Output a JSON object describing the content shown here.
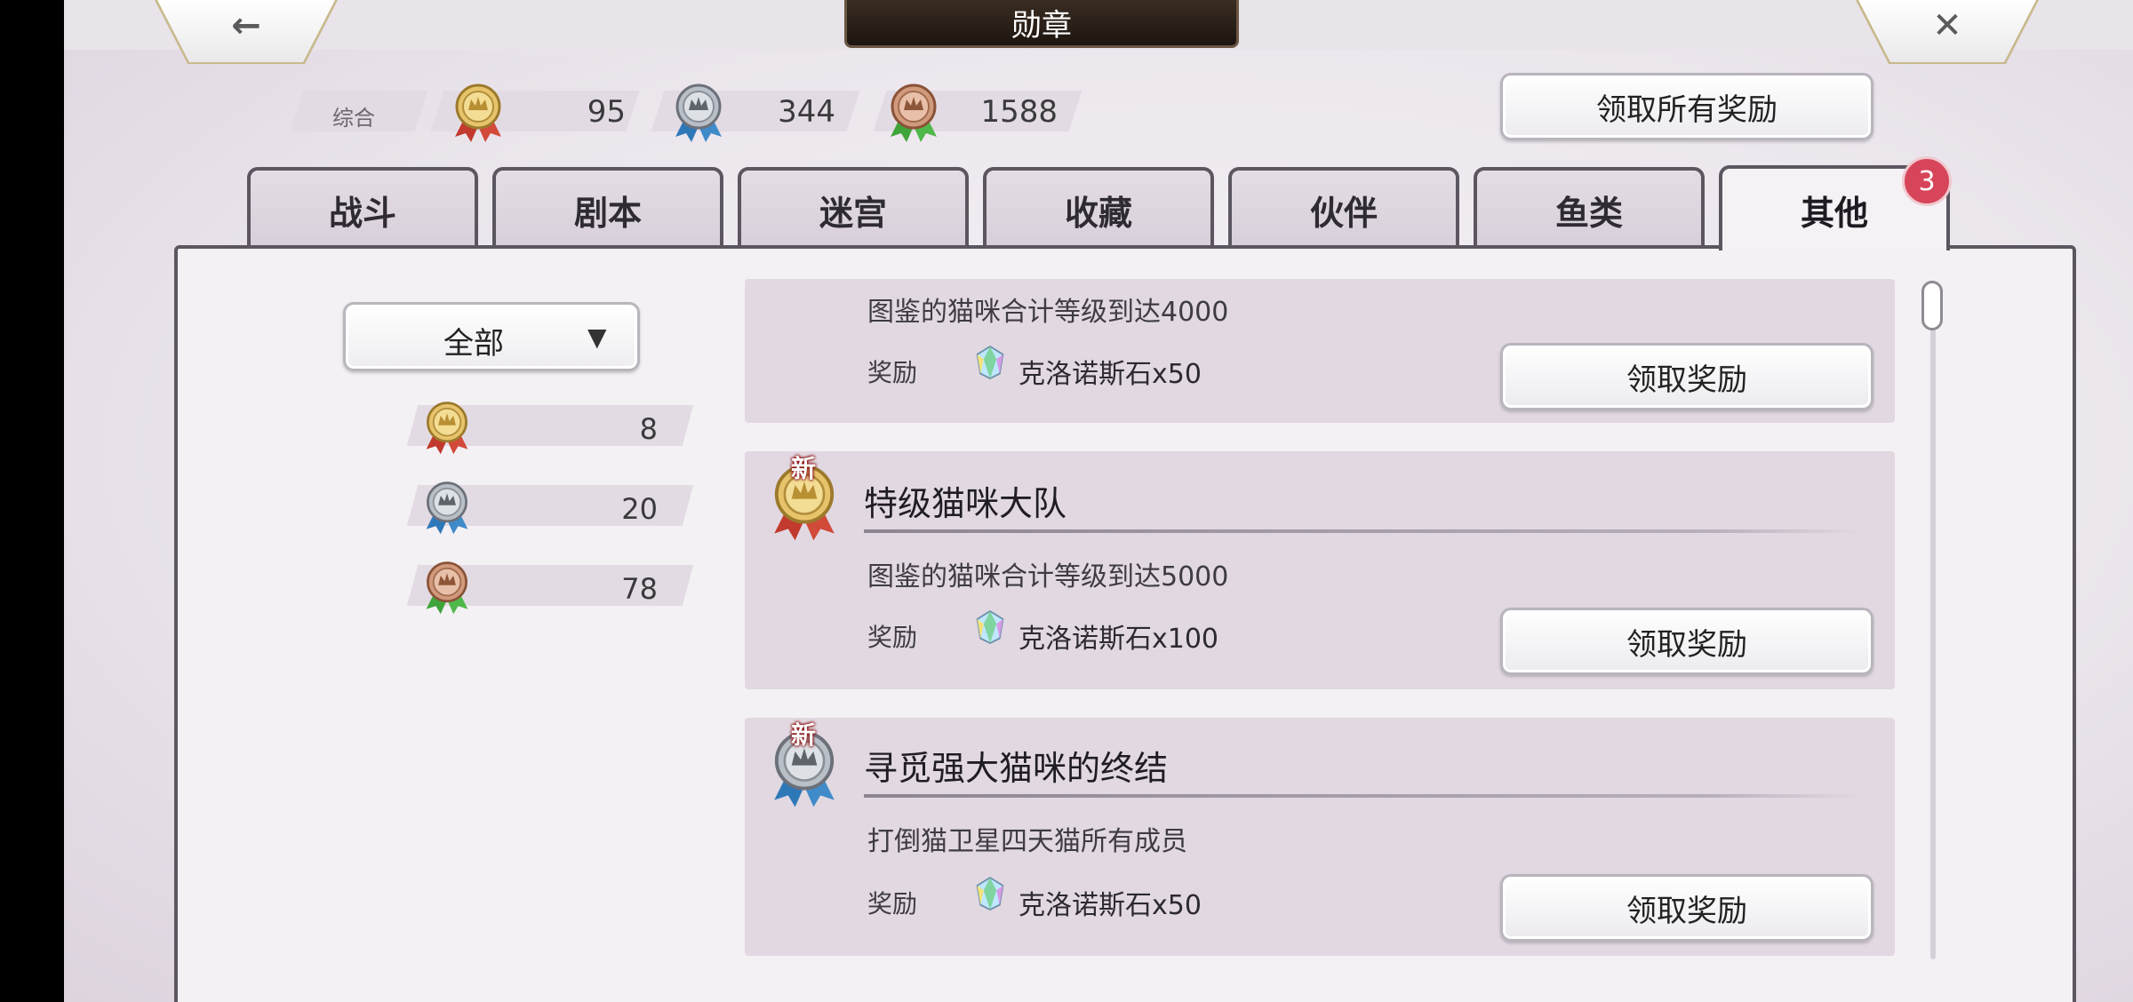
{
  "header": {
    "title": "勋章",
    "back_icon": "arrow-left-icon",
    "close_icon": "close-icon"
  },
  "summary": {
    "label": "综合",
    "gold": "95",
    "silver": "344",
    "bronze": "1588",
    "claim_all_label": "领取所有奖励"
  },
  "tabs": [
    "战斗",
    "剧本",
    "迷宫",
    "收藏",
    "伙伴",
    "鱼类",
    "其他"
  ],
  "active_tab": "其他",
  "tab_badge": "3",
  "filter": {
    "selected": "全部",
    "gold_count": "8",
    "silver_count": "20",
    "bronze_count": "78"
  },
  "cards": [
    {
      "title": "",
      "description": "图鉴的猫咪合计等级到达4000",
      "reward_label": "奖励",
      "reward": "克洛诺斯石x50",
      "button": "领取奖励"
    },
    {
      "title": "特级猫咪大队",
      "new_tag": "新",
      "medal": "gold",
      "description": "图鉴的猫咪合计等级到达5000",
      "reward_label": "奖励",
      "reward": "克洛诺斯石x100",
      "button": "领取奖励"
    },
    {
      "title": "寻觅强大猫咪的终结",
      "new_tag": "新",
      "medal": "silver",
      "description": "打倒猫卫星四天猫所有成员",
      "reward_label": "奖励",
      "reward": "克洛诺斯石x50",
      "button": "领取奖励"
    }
  ],
  "colors": {
    "gold_medal": "#c9a44a",
    "silver_medal": "#9aa0a8",
    "bronze_medal": "#b9795a",
    "badge": "#d7455a",
    "title_plate": "#2a2019"
  }
}
